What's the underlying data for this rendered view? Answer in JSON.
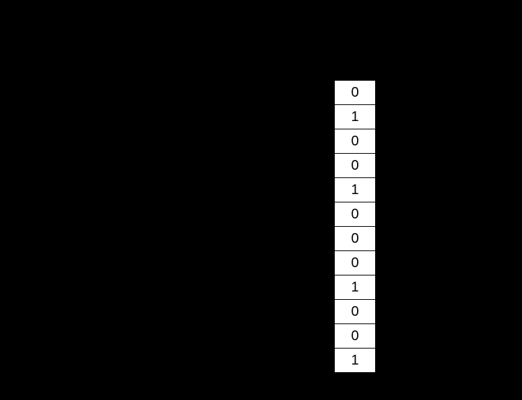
{
  "column": {
    "cells": [
      "0",
      "1",
      "0",
      "0",
      "1",
      "0",
      "0",
      "0",
      "1",
      "0",
      "0",
      "1"
    ]
  }
}
